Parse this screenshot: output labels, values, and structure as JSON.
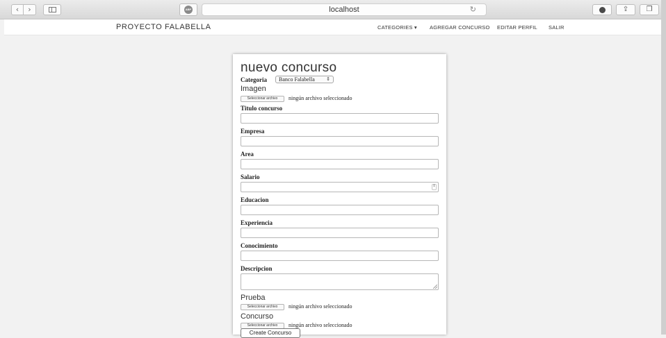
{
  "browser": {
    "back_glyph": "‹",
    "forward_glyph": "›",
    "abp_label": "ABP",
    "url": "localhost",
    "reload_glyph": "↻",
    "share_glyph": "⇪",
    "tabs_glyph": "❐"
  },
  "nav": {
    "brand": "PROYECTO FALABELLA",
    "items": [
      {
        "label": "CATEGORIES ▾"
      },
      {
        "label": "AGREGAR CONCURSO"
      },
      {
        "label": "EDITAR PERFIL"
      },
      {
        "label": "SALIR"
      }
    ]
  },
  "form": {
    "title": "nuevo concurso",
    "category_label": "Categoria",
    "category_value": "Banco Falabella",
    "category_arrow": "⇕",
    "imagen_label": "Imagen",
    "file_button": "Seleccionar archivo",
    "file_none": "ningún archivo seleccionado",
    "fields": [
      {
        "label": "Titulo concurso"
      },
      {
        "label": "Empresa"
      },
      {
        "label": "Area"
      },
      {
        "label": "Salario"
      },
      {
        "label": "Educacion"
      },
      {
        "label": "Experiencia"
      },
      {
        "label": "Conocimiento"
      },
      {
        "label": "Descripcion"
      }
    ],
    "spinner_glyph": "⇕",
    "prueba_label": "Prueba",
    "concurso_label": "Concurso",
    "submit": "Create Concurso"
  }
}
